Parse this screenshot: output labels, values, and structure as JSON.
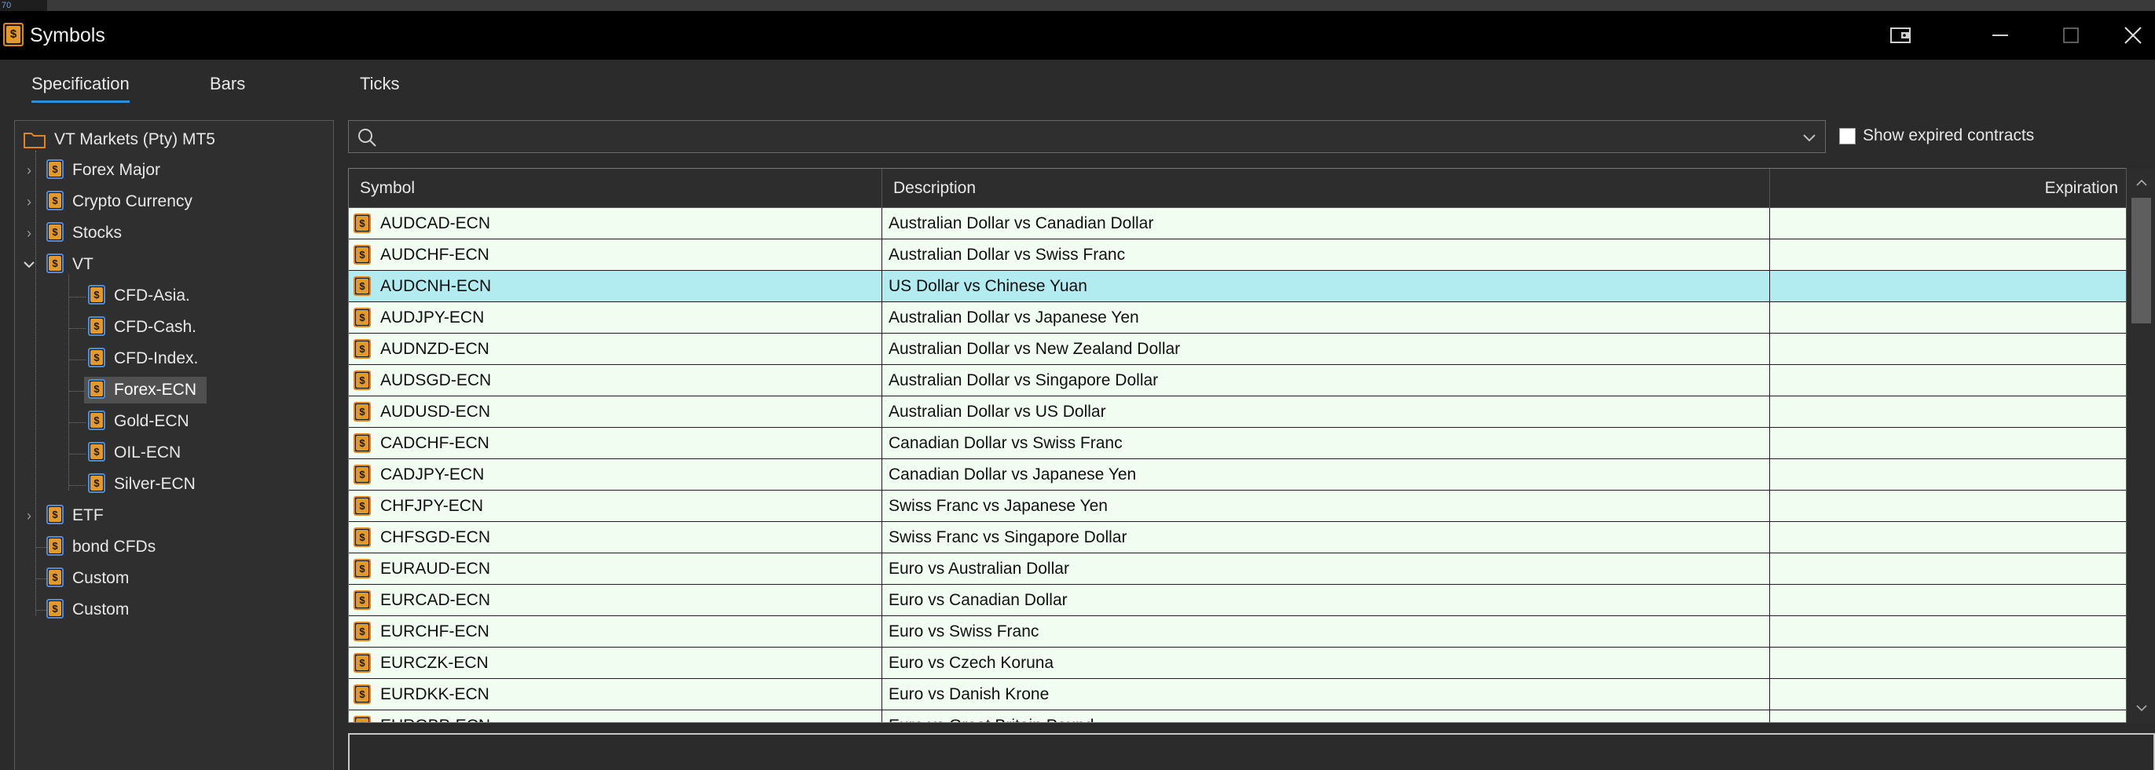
{
  "taskbar": {
    "text": "70"
  },
  "window": {
    "title": "Symbols"
  },
  "tabs": [
    {
      "label": "Specification",
      "active": true
    },
    {
      "label": "Bars",
      "active": false
    },
    {
      "label": "Ticks",
      "active": false
    }
  ],
  "tree": {
    "root": "VT Markets (Pty) MT5",
    "groups": [
      {
        "label": "Forex Major",
        "expanded": false
      },
      {
        "label": "Crypto Currency",
        "expanded": false
      },
      {
        "label": "Stocks",
        "expanded": false
      },
      {
        "label": "VT",
        "expanded": true
      },
      {
        "label": "ETF",
        "expanded": false
      },
      {
        "label": "bond CFDs"
      },
      {
        "label": "Custom"
      },
      {
        "label": "Custom"
      }
    ],
    "vt_children": [
      "CFD-Asia.",
      "CFD-Cash.",
      "CFD-Index.",
      "Forex-ECN",
      "Gold-ECN",
      "OIL-ECN",
      "Silver-ECN"
    ],
    "selected": "Forex-ECN"
  },
  "search": {
    "value": "",
    "placeholder": ""
  },
  "show_expired": {
    "label": "Show expired contracts",
    "checked": false
  },
  "table": {
    "columns": {
      "symbol": "Symbol",
      "description": "Description",
      "expiration": "Expiration"
    },
    "rows": [
      {
        "symbol": "AUDCAD-ECN",
        "description": "Australian Dollar vs Canadian Dollar",
        "expiration": ""
      },
      {
        "symbol": "AUDCHF-ECN",
        "description": "Australian Dollar vs Swiss Franc",
        "expiration": ""
      },
      {
        "symbol": "AUDCNH-ECN",
        "description": "US Dollar vs Chinese Yuan",
        "expiration": "",
        "selected": true
      },
      {
        "symbol": "AUDJPY-ECN",
        "description": "Australian Dollar vs Japanese Yen",
        "expiration": ""
      },
      {
        "symbol": "AUDNZD-ECN",
        "description": "Australian Dollar vs New Zealand Dollar",
        "expiration": ""
      },
      {
        "symbol": "AUDSGD-ECN",
        "description": "Australian Dollar vs Singapore Dollar",
        "expiration": ""
      },
      {
        "symbol": "AUDUSD-ECN",
        "description": "Australian Dollar vs US Dollar",
        "expiration": ""
      },
      {
        "symbol": "CADCHF-ECN",
        "description": "Canadian Dollar vs Swiss Franc",
        "expiration": ""
      },
      {
        "symbol": "CADJPY-ECN",
        "description": "Canadian Dollar vs Japanese Yen",
        "expiration": ""
      },
      {
        "symbol": "CHFJPY-ECN",
        "description": "Swiss Franc vs Japanese Yen",
        "expiration": ""
      },
      {
        "symbol": "CHFSGD-ECN",
        "description": "Swiss Franc vs Singapore Dollar",
        "expiration": ""
      },
      {
        "symbol": "EURAUD-ECN",
        "description": "Euro vs Australian Dollar",
        "expiration": ""
      },
      {
        "symbol": "EURCAD-ECN",
        "description": "Euro vs Canadian Dollar",
        "expiration": ""
      },
      {
        "symbol": "EURCHF-ECN",
        "description": "Euro vs Swiss Franc",
        "expiration": ""
      },
      {
        "symbol": "EURCZK-ECN",
        "description": "Euro vs Czech Koruna",
        "expiration": ""
      },
      {
        "symbol": "EURDKK-ECN",
        "description": "Euro vs Danish Krone",
        "expiration": ""
      },
      {
        "symbol": "EURGBP-ECN",
        "description": "Euro vs Great Britain Pound",
        "expiration": ""
      }
    ]
  },
  "icons": {
    "symbol": "dollar-coin-icon",
    "folder": "folder-icon",
    "search": "search-icon"
  },
  "colors": {
    "accent": "#2e8fd8",
    "coin": "#e39a2a",
    "row_bg": "#f2fdf2",
    "row_selected": "#b2ecf0"
  }
}
